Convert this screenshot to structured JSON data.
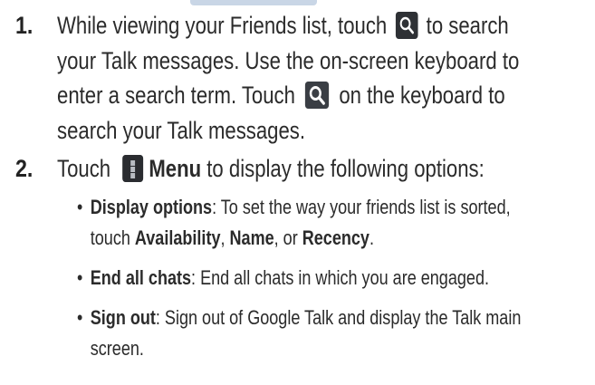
{
  "steps": [
    {
      "number": "1.",
      "lines": [
        [
          "While viewing your Friends list, touch ",
          " to search"
        ],
        [
          "your Talk messages. Use the on-screen keyboard to"
        ],
        [
          "enter a search term. Touch ",
          " on the keyboard to"
        ],
        [
          "search your Talk messages."
        ]
      ],
      "icons": [
        "search-icon",
        "search-key-icon"
      ]
    },
    {
      "number": "2.",
      "intro_prefix": "Touch ",
      "intro_bold": "Menu",
      "intro_suffix": " to display the following options:",
      "icon": "menu-icon",
      "bullets": [
        {
          "term": "Display options",
          "text_1": ": To set the way your friends list is sorted,",
          "text_2": "touch ",
          "opt_1": "Availability",
          "sep_1": ", ",
          "opt_2": "Name",
          "sep_2": ", or ",
          "opt_3": "Recency",
          "end": "."
        },
        {
          "term": "End all chats",
          "text_1": ": End all chats in which you are engaged."
        },
        {
          "term": "Sign out",
          "text_1": ": Sign out of Google Talk and display the Talk main",
          "text_2": "screen."
        }
      ]
    }
  ],
  "colors": {
    "text": "#2b2b2b",
    "icon_bg": "#2e3135",
    "icon_glyph": "#ffffff"
  }
}
